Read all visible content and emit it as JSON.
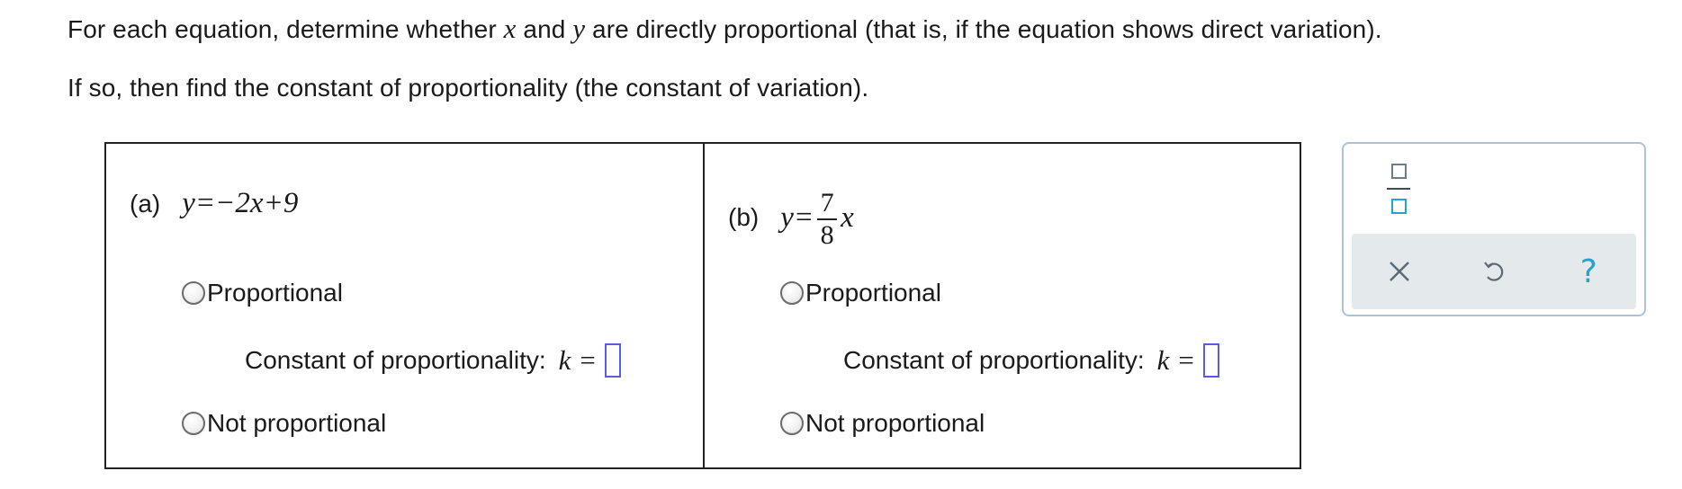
{
  "prompt": {
    "line1_pre": "For each equation, determine whether ",
    "var_x": "x",
    "line1_mid": " and ",
    "var_y": "y",
    "line1_post": " are directly proportional (that is, if the equation shows direct variation).",
    "line2": "If so, then find the constant of proportionality (the constant of variation)."
  },
  "parts": [
    {
      "tag": "(a)",
      "equation": "y=−2x+9",
      "option_proportional": "Proportional",
      "constant_label": "Constant of proportionality:",
      "constant_var": "k",
      "equals": "=",
      "constant_value": "",
      "option_not_proportional": "Not proportional"
    },
    {
      "tag": "(b)",
      "equation_lhs": "y=",
      "fraction_numerator": "7",
      "fraction_denominator": "8",
      "equation_var": "x",
      "option_proportional": "Proportional",
      "constant_label": "Constant of proportionality:",
      "constant_var": "k",
      "equals": "=",
      "constant_value": "",
      "option_not_proportional": "Not proportional"
    }
  ],
  "toolbar": {
    "icons": [
      "fraction-icon",
      "clear-icon",
      "undo-icon",
      "help-icon"
    ],
    "help_symbol": "?",
    "accent_color": "#27a3c9",
    "border_color": "#a8c4d6"
  }
}
